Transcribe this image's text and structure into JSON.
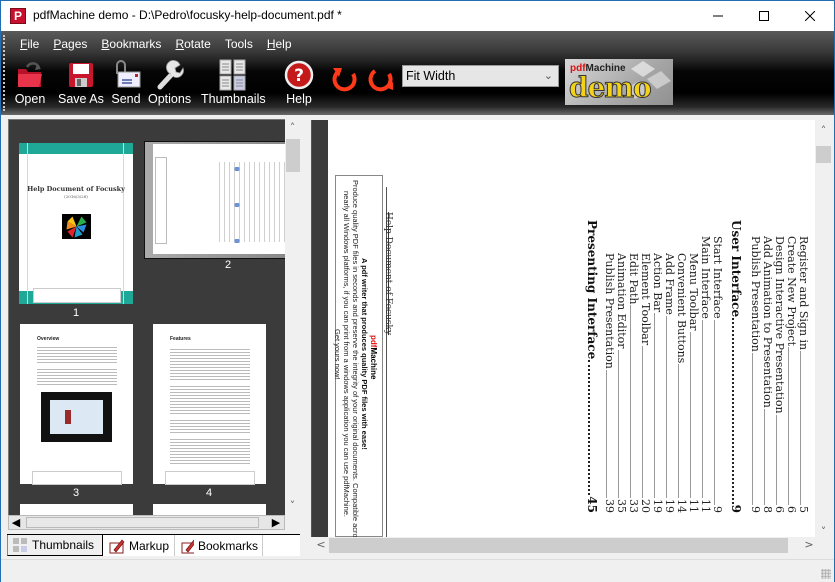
{
  "window": {
    "title": "pdfMachine demo - D:\\Pedro\\focusky-help-document.pdf *",
    "app_icon_glyph": "P",
    "controls": {
      "minimize": "minimize-icon",
      "maximize": "maximize-icon",
      "close": "close-icon"
    }
  },
  "menu": [
    {
      "underline": "F",
      "rest": "ile"
    },
    {
      "underline": "P",
      "rest": "ages"
    },
    {
      "underline": "B",
      "rest": "ookmarks"
    },
    {
      "underline": "R",
      "rest": "otate"
    },
    {
      "underline": "",
      "rest": "Tools"
    },
    {
      "underline": "H",
      "rest": "elp"
    }
  ],
  "toolbar": {
    "open": "Open",
    "save_as": "Save As",
    "send": "Send",
    "options": "Options",
    "thumbnails": "Thumbnails",
    "help": "Help",
    "rotate_left": "rotate-counterclockwise-icon",
    "rotate_right": "rotate-clockwise-icon",
    "zoom_value": "Fit Width",
    "logo_line1_red": "pdf",
    "logo_line1": "Machine",
    "logo_line2": "demo"
  },
  "thumbnails": {
    "pages": [
      {
        "num": "1",
        "title": "Help Document of Focusky",
        "date": "(2016/3/28)"
      },
      {
        "num": "2"
      },
      {
        "num": "3",
        "title": "Overview"
      },
      {
        "num": "4",
        "title": "Features"
      }
    ]
  },
  "panel_tabs": {
    "thumbnails": "Thumbnails",
    "markup": "Markup",
    "bookmarks": "Bookmarks"
  },
  "document": {
    "header": "Help Document of Focusky",
    "footer": {
      "brand_red": "pdf",
      "brand": "Machine",
      "tagline": "A pdf writer that produces quality PDF files with ease!",
      "line1": "Produce quality PDF files in seconds and preserve the integrity of your original documents. Compatible across",
      "line2": "nearly all Windows platforms, if you can print from a windows application you can use pdfMachine.",
      "line3": "Get yours now!"
    },
    "toc": [
      {
        "label": "Register and Sign in",
        "page": "5",
        "level": 2
      },
      {
        "label": "Create New Project",
        "page": "6",
        "level": 2
      },
      {
        "label": "Design Interactive Presentation",
        "page": "6",
        "level": 2
      },
      {
        "label": "Add Animation to Presentation",
        "page": "8",
        "level": 2
      },
      {
        "label": "Publish Presentation",
        "page": "9",
        "level": 2
      },
      {
        "label": "User Interface",
        "page": "9",
        "level": 1
      },
      {
        "label": "Start Interface",
        "page": "9",
        "level": 2
      },
      {
        "label": "Main Interface",
        "page": "11",
        "level": 2
      },
      {
        "label": "Menu Toolbar",
        "page": "11",
        "level": 3
      },
      {
        "label": "Convenient Buttons",
        "page": "14",
        "level": 3
      },
      {
        "label": "Add Frame",
        "page": "19",
        "level": 3
      },
      {
        "label": "Action Bar",
        "page": "19",
        "level": 3
      },
      {
        "label": "Element Toolbar",
        "page": "20",
        "level": 3
      },
      {
        "label": "Edit Path",
        "page": "33",
        "level": 3
      },
      {
        "label": "Animation Editor",
        "page": "35",
        "level": 3
      },
      {
        "label": "Publish Presentation",
        "page": "39",
        "level": 3
      },
      {
        "label": "Presenting Interface",
        "page": "45",
        "level": 1
      }
    ]
  }
}
